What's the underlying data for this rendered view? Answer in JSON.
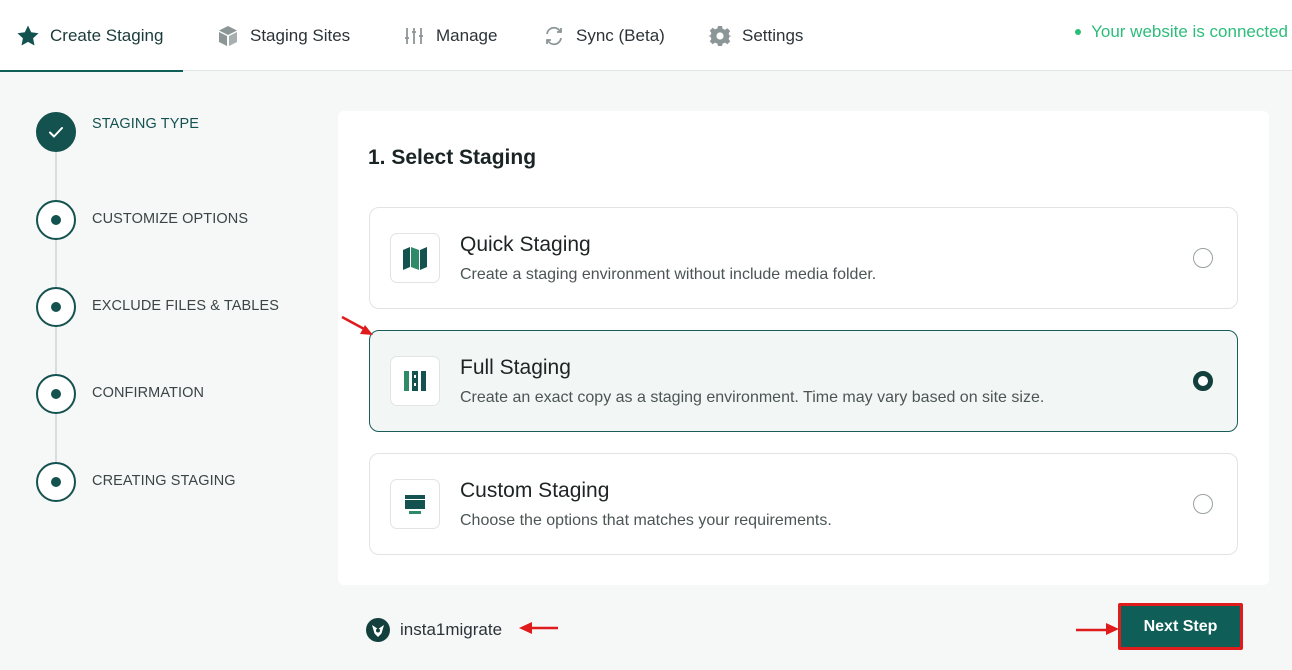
{
  "nav": {
    "tabs": [
      {
        "label": "Create Staging",
        "icon": "star-icon",
        "active": true
      },
      {
        "label": "Staging Sites",
        "icon": "cube-icon",
        "active": false
      },
      {
        "label": "Manage",
        "icon": "sliders-icon",
        "active": false
      },
      {
        "label": "Sync (Beta)",
        "icon": "sync-icon",
        "active": false
      },
      {
        "label": "Settings",
        "icon": "gear-icon",
        "active": false
      }
    ],
    "status": "Your website is connected"
  },
  "steps": [
    {
      "label": "STAGING TYPE",
      "state": "completed"
    },
    {
      "label": "CUSTOMIZE OPTIONS",
      "state": "pending"
    },
    {
      "label": "EXCLUDE FILES & TABLES",
      "state": "pending"
    },
    {
      "label": "CONFIRMATION",
      "state": "pending"
    },
    {
      "label": "CREATING STAGING",
      "state": "pending"
    }
  ],
  "main": {
    "title": "1. Select Staging",
    "options": [
      {
        "title": "Quick Staging",
        "description": "Create a staging environment without include media folder.",
        "icon": "map-icon",
        "selected": false
      },
      {
        "title": "Full Staging",
        "description": "Create an exact copy as a staging environment. Time may vary based on site size.",
        "icon": "columns-icon",
        "selected": true
      },
      {
        "title": "Custom Staging",
        "description": "Choose the options that matches your requirements.",
        "icon": "window-icon",
        "selected": false
      }
    ]
  },
  "footer": {
    "brand": "insta1migrate",
    "brand_icon": "insta-logo-icon",
    "next_label": "Next Step"
  },
  "colors": {
    "accent": "#0f5f58",
    "dark_accent": "#14524f",
    "connected": "#2dbd7b",
    "annotation_red": "#e01b1b"
  }
}
